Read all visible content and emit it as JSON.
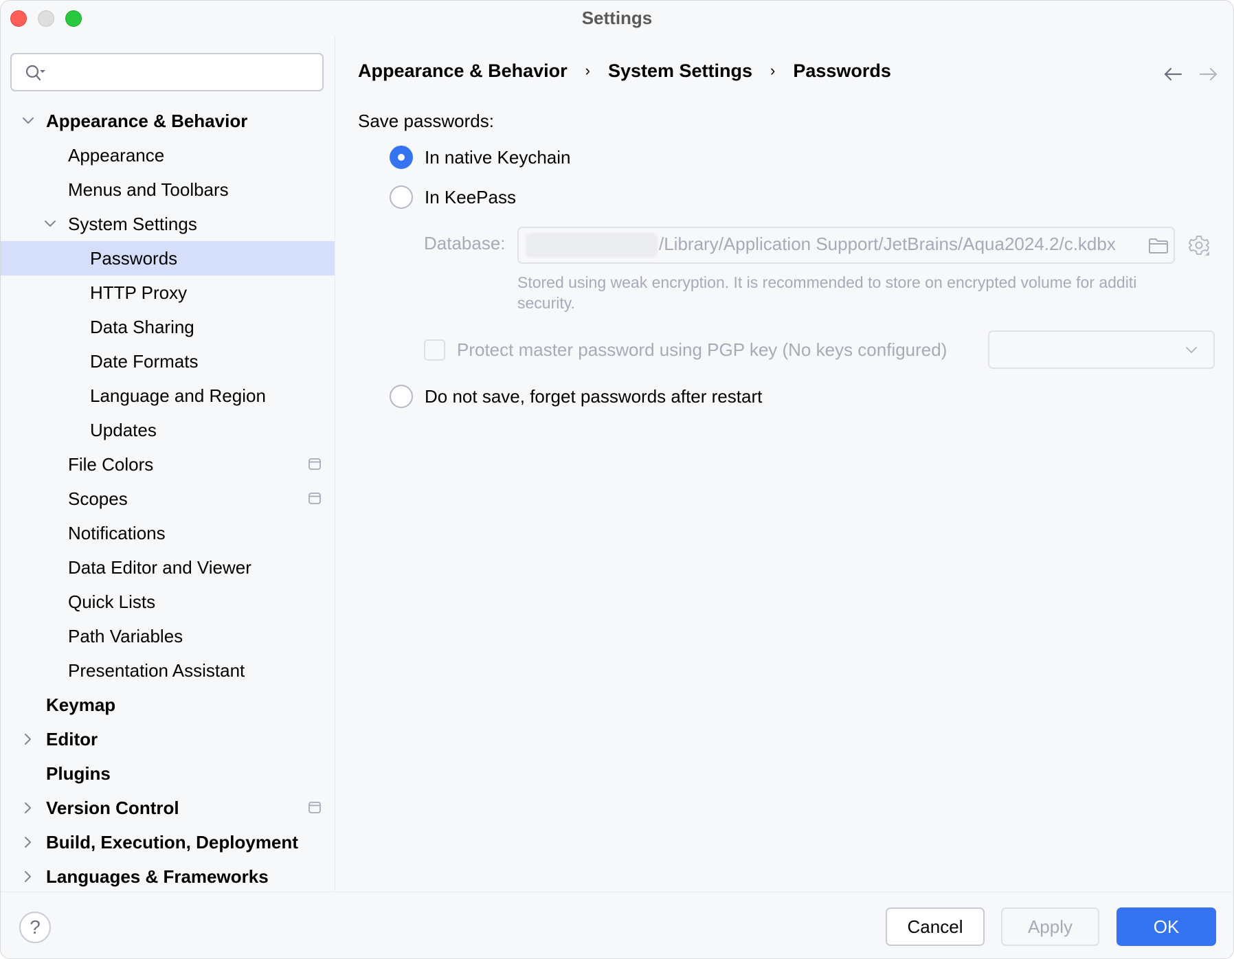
{
  "window": {
    "title": "Settings"
  },
  "search": {
    "value": "",
    "placeholder": ""
  },
  "sidebar": {
    "items": [
      {
        "label": "Appearance & Behavior",
        "level": 0,
        "bold": true,
        "expander": "expanded",
        "project_icon": false,
        "selected": false
      },
      {
        "label": "Appearance",
        "level": 1,
        "bold": false,
        "expander": "none",
        "project_icon": false,
        "selected": false
      },
      {
        "label": "Menus and Toolbars",
        "level": 1,
        "bold": false,
        "expander": "none",
        "project_icon": false,
        "selected": false
      },
      {
        "label": "System Settings",
        "level": 1,
        "bold": false,
        "expander": "expanded",
        "project_icon": false,
        "selected": false
      },
      {
        "label": "Passwords",
        "level": 2,
        "bold": false,
        "expander": "none",
        "project_icon": false,
        "selected": true
      },
      {
        "label": "HTTP Proxy",
        "level": 2,
        "bold": false,
        "expander": "none",
        "project_icon": false,
        "selected": false
      },
      {
        "label": "Data Sharing",
        "level": 2,
        "bold": false,
        "expander": "none",
        "project_icon": false,
        "selected": false
      },
      {
        "label": "Date Formats",
        "level": 2,
        "bold": false,
        "expander": "none",
        "project_icon": false,
        "selected": false
      },
      {
        "label": "Language and Region",
        "level": 2,
        "bold": false,
        "expander": "none",
        "project_icon": false,
        "selected": false
      },
      {
        "label": "Updates",
        "level": 2,
        "bold": false,
        "expander": "none",
        "project_icon": false,
        "selected": false
      },
      {
        "label": "File Colors",
        "level": 1,
        "bold": false,
        "expander": "none",
        "project_icon": true,
        "selected": false
      },
      {
        "label": "Scopes",
        "level": 1,
        "bold": false,
        "expander": "none",
        "project_icon": true,
        "selected": false
      },
      {
        "label": "Notifications",
        "level": 1,
        "bold": false,
        "expander": "none",
        "project_icon": false,
        "selected": false
      },
      {
        "label": "Data Editor and Viewer",
        "level": 1,
        "bold": false,
        "expander": "none",
        "project_icon": false,
        "selected": false
      },
      {
        "label": "Quick Lists",
        "level": 1,
        "bold": false,
        "expander": "none",
        "project_icon": false,
        "selected": false
      },
      {
        "label": "Path Variables",
        "level": 1,
        "bold": false,
        "expander": "none",
        "project_icon": false,
        "selected": false
      },
      {
        "label": "Presentation Assistant",
        "level": 1,
        "bold": false,
        "expander": "none",
        "project_icon": false,
        "selected": false
      },
      {
        "label": "Keymap",
        "level": 0,
        "bold": true,
        "expander": "none",
        "project_icon": false,
        "selected": false
      },
      {
        "label": "Editor",
        "level": 0,
        "bold": true,
        "expander": "collapsed",
        "project_icon": false,
        "selected": false
      },
      {
        "label": "Plugins",
        "level": 0,
        "bold": true,
        "expander": "none",
        "project_icon": false,
        "selected": false
      },
      {
        "label": "Version Control",
        "level": 0,
        "bold": true,
        "expander": "collapsed",
        "project_icon": true,
        "selected": false
      },
      {
        "label": "Build, Execution, Deployment",
        "level": 0,
        "bold": true,
        "expander": "collapsed",
        "project_icon": false,
        "selected": false
      },
      {
        "label": "Languages & Frameworks",
        "level": 0,
        "bold": true,
        "expander": "collapsed",
        "project_icon": false,
        "selected": false
      }
    ]
  },
  "breadcrumb": {
    "items": [
      "Appearance & Behavior",
      "System Settings",
      "Passwords"
    ],
    "separator": "›"
  },
  "passwords": {
    "section_label": "Save passwords:",
    "options": [
      {
        "label": "In native Keychain",
        "checked": true
      },
      {
        "label": "In KeePass",
        "checked": false
      },
      {
        "label": "Do not save, forget passwords after restart",
        "checked": false
      }
    ],
    "database": {
      "label": "Database:",
      "value_visible": "/Library/Application Support/JetBrains/Aqua2024.2/c.kdbx",
      "value_redacted_prefix": true
    },
    "hint_line1": "Stored using weak encryption. It is recommended to store on encrypted volume for additi",
    "hint_line2": "security.",
    "pgp": {
      "label": "Protect master password using PGP key (No keys configured)",
      "checked": false,
      "enabled": false,
      "selected_key": ""
    }
  },
  "footer": {
    "help_label": "?",
    "cancel_label": "Cancel",
    "apply_label": "Apply",
    "ok_label": "OK"
  },
  "colors": {
    "accent": "#3574F0",
    "selection": "#D5DFFC",
    "disabled_text": "#A7ABB8",
    "background": "#F7F8FA"
  }
}
